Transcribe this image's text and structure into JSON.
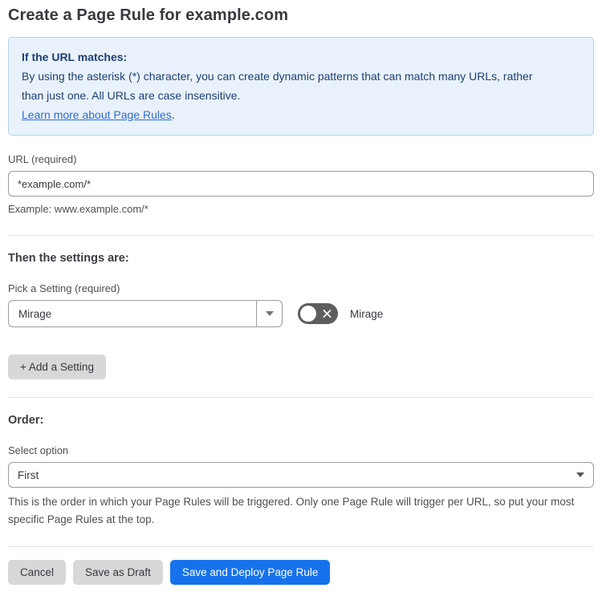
{
  "page": {
    "title": "Create a Page Rule for example.com"
  },
  "info_box": {
    "heading": "If the URL matches:",
    "body": "By using the asterisk (*) character, you can create dynamic patterns that can match many URLs, rather than just one. All URLs are case insensitive.",
    "link_label": "Learn more about Page Rules",
    "link_suffix": "."
  },
  "url_section": {
    "label": "URL (required)",
    "value": "*example.com/*",
    "helper": "Example: www.example.com/*"
  },
  "settings_section": {
    "heading": "Then the settings are:",
    "setting_label": "Pick a Setting (required)",
    "setting_value": "Mirage",
    "toggle_label": "Mirage",
    "toggle_state": "off",
    "add_setting_label": "+ Add a Setting"
  },
  "order_section": {
    "heading": "Order:",
    "label": "Select option",
    "value": "First",
    "helper": "This is the order in which your Page Rules will be triggered. Only one Page Rule will trigger per URL, so put your most specific Page Rules at the top."
  },
  "footer": {
    "cancel_label": "Cancel",
    "save_draft_label": "Save as Draft",
    "save_deploy_label": "Save and Deploy Page Rule"
  },
  "colors": {
    "accent_blue": "#1672ec",
    "info_bg": "#e9f2fc",
    "info_border": "#b0d0ef",
    "info_text": "#1e3e78",
    "link_blue": "#2f6bd8",
    "toggle_off": "#5d5e60"
  }
}
